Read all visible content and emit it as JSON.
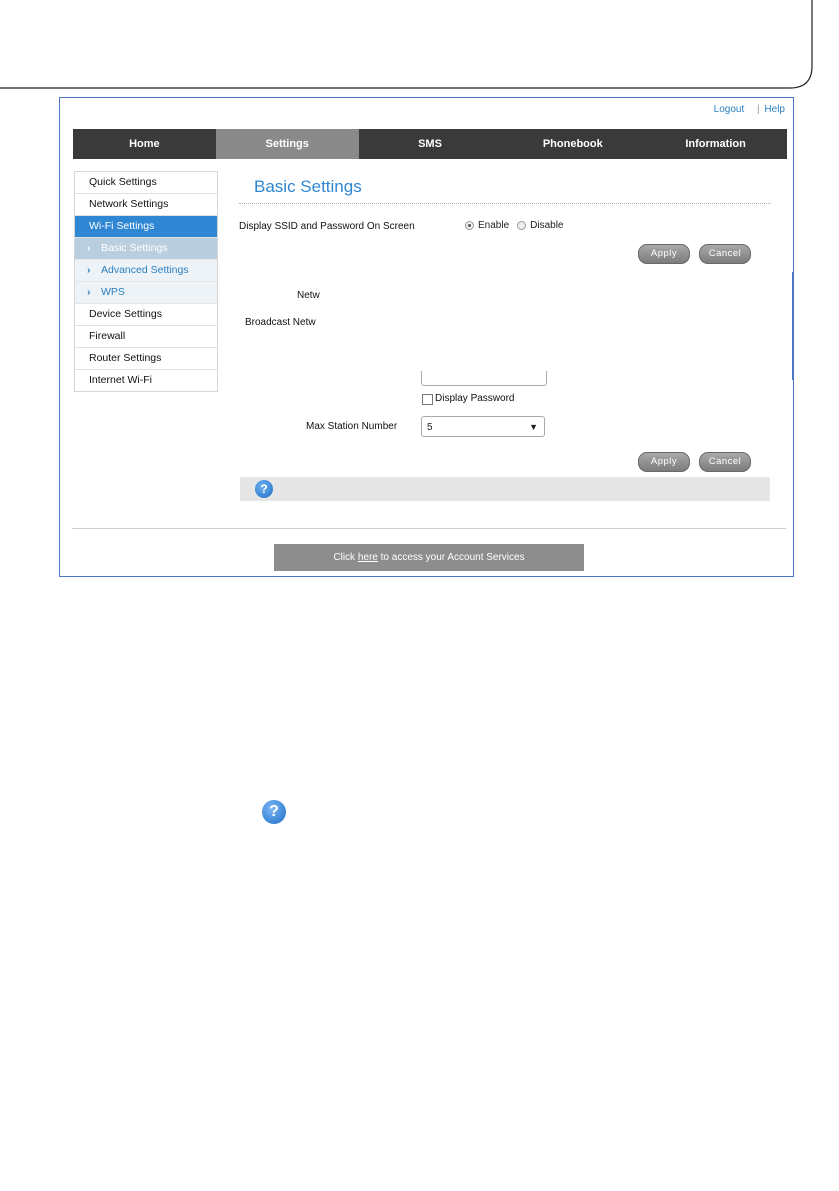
{
  "header_links": {
    "logout": "Logout",
    "help": "Help"
  },
  "nav": [
    "Home",
    "Settings",
    "SMS",
    "Phonebook",
    "Information"
  ],
  "sidebar": {
    "items": [
      {
        "label": "Quick Settings"
      },
      {
        "label": "Network Settings"
      },
      {
        "label": "Wi-Fi Settings"
      }
    ],
    "sub": [
      {
        "label": "Basic Settings"
      },
      {
        "label": "Advanced Settings"
      },
      {
        "label": "WPS"
      }
    ],
    "items2": [
      {
        "label": "Device Settings"
      },
      {
        "label": "Firewall"
      },
      {
        "label": "Router Settings"
      },
      {
        "label": "Internet Wi-Fi"
      }
    ]
  },
  "main": {
    "title": "Basic Settings",
    "ssid_display_label": "Display SSID and Password On Screen",
    "enable_label": "Enable",
    "disable_label": "Disable",
    "apply": "Apply",
    "cancel": "Cancel",
    "network_label": "Netw",
    "broadcast_label": "Broadcast Netw",
    "display_password_label": "Display Password",
    "max_station_label": "Max Station Number",
    "max_station_value": "5"
  },
  "footer": {
    "account_prefix": "Click ",
    "account_link": "here",
    "account_suffix": " to access your Account Services"
  },
  "icons": {
    "help": "question-mark-icon",
    "dropdown": "triangle-down-icon"
  },
  "colors": {
    "accent": "#2f86d3",
    "nav_bg": "#3a3a3a",
    "frame_border": "#4a78c0"
  }
}
